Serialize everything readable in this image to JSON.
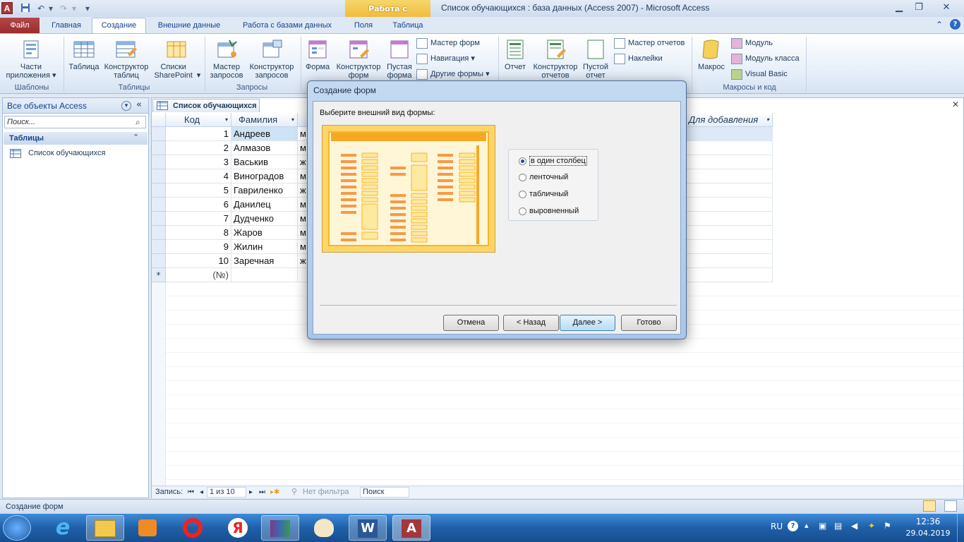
{
  "titlebar": {
    "app_icon": "A",
    "context_tab": "Работа с таблицами",
    "title": "Список обучающихся : база данных (Access 2007)  -  Microsoft Access",
    "qat_icons": [
      "save-icon",
      "undo-icon",
      "redo-icon",
      "customize-icon"
    ],
    "controls": [
      "minimize-icon",
      "restore-icon",
      "close-icon"
    ]
  },
  "tabs": [
    "Файл",
    "Главная",
    "Создание",
    "Внешние данные",
    "Работа с базами данных",
    "Поля",
    "Таблица"
  ],
  "ribbon": {
    "groups": {
      "templates": {
        "label": "Шаблоны",
        "buttons": [
          "Части приложения"
        ]
      },
      "tables": {
        "label": "Таблицы",
        "buttons": [
          "Таблица",
          "Конструктор таблиц",
          "Списки SharePoint"
        ]
      },
      "queries": {
        "label": "Запросы",
        "buttons": [
          "Мастер запросов",
          "Конструктор запросов"
        ]
      },
      "forms": {
        "big": [
          "Форма",
          "Конструктор форм",
          "Пустая форма"
        ],
        "small": [
          "Мастер форм",
          "Навигация",
          "Другие формы"
        ]
      },
      "reports": {
        "big": [
          "Отчет",
          "Конструктор отчетов",
          "Пустой отчет"
        ],
        "small": [
          "Мастер отчетов",
          "Наклейки"
        ]
      },
      "macros": {
        "label": "Макросы и код",
        "big": [
          "Макрос"
        ],
        "small": [
          "Модуль",
          "Модуль класса",
          "Visual Basic"
        ]
      }
    }
  },
  "nav": {
    "header": "Все объекты Access",
    "search_placeholder": "Поиск...",
    "group": "Таблицы",
    "items": [
      "Список обучающихся"
    ]
  },
  "doc": {
    "tab": "Список обучающихся",
    "columns": [
      "Код",
      "Фамилия",
      "",
      "Для добавления"
    ],
    "rows": [
      {
        "id": "1",
        "surname": "Андреев",
        "c3": "м"
      },
      {
        "id": "2",
        "surname": "Алмазов",
        "c3": "м"
      },
      {
        "id": "3",
        "surname": "Васькив",
        "c3": "ж"
      },
      {
        "id": "4",
        "surname": "Виноградов",
        "c3": "м"
      },
      {
        "id": "5",
        "surname": "Гавриленко",
        "c3": "ж"
      },
      {
        "id": "6",
        "surname": "Данилец",
        "c3": "м"
      },
      {
        "id": "7",
        "surname": "Дудченко",
        "c3": "м"
      },
      {
        "id": "8",
        "surname": "Жаров",
        "c3": "м"
      },
      {
        "id": "9",
        "surname": "Жилин",
        "c3": "м"
      },
      {
        "id": "10",
        "surname": "Заречная",
        "c3": "ж"
      }
    ],
    "new_row": "(№)",
    "new_row_marker": "*"
  },
  "recnav": {
    "label": "Запись:",
    "position": "1 из 10",
    "filter": "Нет фильтра",
    "search": "Поиск"
  },
  "status": {
    "text": "Создание форм"
  },
  "dialog": {
    "title": "Создание форм",
    "prompt": "Выберите внешний вид формы:",
    "options": [
      "в один столбец",
      "ленточный",
      "табличный",
      "выровненный"
    ],
    "selected": 0,
    "buttons": {
      "cancel": "Отмена",
      "back": "< Назад",
      "next": "Далее >",
      "finish": "Готово"
    }
  },
  "taskbar": {
    "apps": [
      "explorer-icon",
      "ie-icon",
      "media-icon",
      "opera-icon",
      "yandex-icon",
      "winrar-icon",
      "paint-icon",
      "word-icon",
      "access-icon"
    ],
    "lang": "RU",
    "time": "12:36",
    "date": "29.04.2019"
  }
}
